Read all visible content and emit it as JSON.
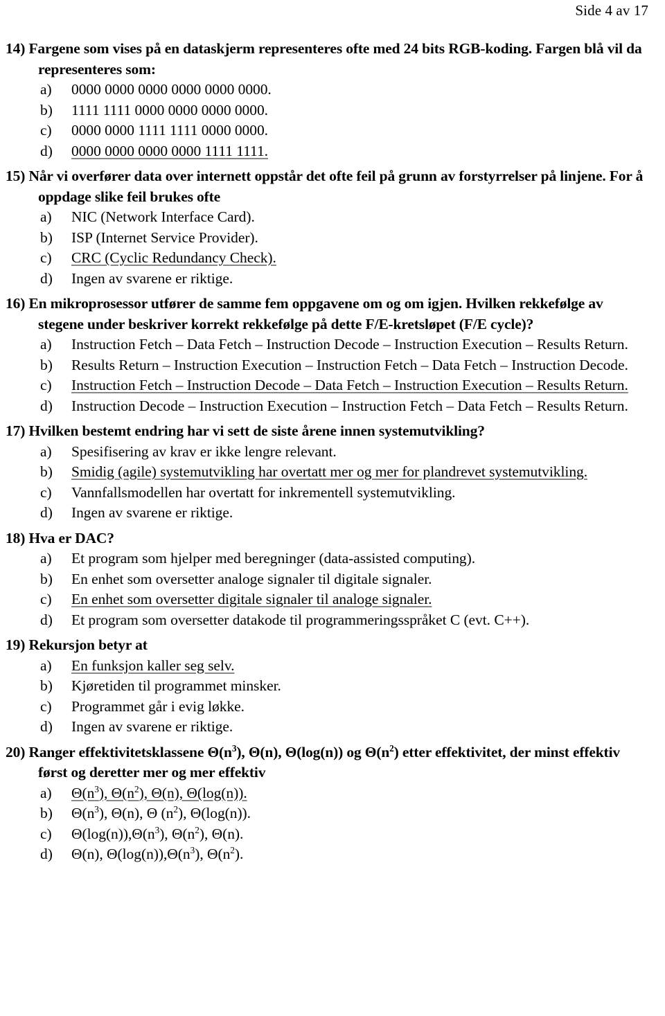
{
  "header": {
    "page_label": "Side 4 av 17"
  },
  "questions": [
    {
      "number": "14)",
      "stem": "Fargene som vises på en dataskjerm representeres ofte med 24 bits RGB-koding. Fargen blå vil da representeres som:",
      "options": [
        {
          "letter": "a)",
          "text": "0000 0000 0000 0000 0000 0000.",
          "answer": false
        },
        {
          "letter": "b)",
          "text": "1111 1111 0000 0000 0000 0000.",
          "answer": false
        },
        {
          "letter": "c)",
          "text": "0000 0000 1111 1111 0000 0000.",
          "answer": false
        },
        {
          "letter": "d)",
          "text": "0000 0000 0000 0000 1111 1111.",
          "answer": true
        }
      ]
    },
    {
      "number": "15)",
      "stem": "Når vi overfører data over internett oppstår det ofte feil på grunn av forstyrrelser på linjene. For å oppdage slike feil brukes ofte",
      "options": [
        {
          "letter": "a)",
          "text": "NIC (Network Interface Card).",
          "answer": false
        },
        {
          "letter": "b)",
          "text": "ISP (Internet Service Provider).",
          "answer": false
        },
        {
          "letter": "c)",
          "text": "CRC (Cyclic Redundancy Check).",
          "answer": true
        },
        {
          "letter": "d)",
          "text": "Ingen av svarene er riktige.",
          "answer": false
        }
      ]
    },
    {
      "number": "16)",
      "stem": "En mikroprosessor utfører de samme fem oppgavene om og om igjen. Hvilken rekkefølge av stegene under beskriver korrekt rekkefølge på dette F/E-kretsløpet (F/E cycle)?",
      "options": [
        {
          "letter": "a)",
          "text": "Instruction Fetch – Data Fetch – Instruction Decode – Instruction Execution – Results Return.",
          "answer": false
        },
        {
          "letter": "b)",
          "text": "Results Return – Instruction Execution – Instruction Fetch – Data Fetch – Instruction Decode.",
          "answer": false
        },
        {
          "letter": "c)",
          "text": "Instruction Fetch – Instruction Decode – Data Fetch – Instruction Execution – Results Return.",
          "answer": true
        },
        {
          "letter": "d)",
          "text": "Instruction Decode – Instruction Execution – Instruction Fetch – Data Fetch – Results Return.",
          "answer": false
        }
      ]
    },
    {
      "number": "17)",
      "stem": "Hvilken bestemt endring har vi sett de siste årene innen systemutvikling?",
      "options": [
        {
          "letter": "a)",
          "text": "Spesifisering av krav er ikke lengre relevant.",
          "answer": false
        },
        {
          "letter": "b)",
          "text": "Smidig (agile) systemutvikling har overtatt mer og mer for plandrevet systemutvikling.",
          "answer": true
        },
        {
          "letter": "c)",
          "text": "Vannfallsmodellen har overtatt for inkrementell systemutvikling.",
          "answer": false
        },
        {
          "letter": "d)",
          "text": "Ingen av svarene er riktige.",
          "answer": false
        }
      ]
    },
    {
      "number": "18)",
      "stem": "Hva er DAC?",
      "options": [
        {
          "letter": "a)",
          "text": "Et program som hjelper med beregninger (data-assisted computing).",
          "answer": false
        },
        {
          "letter": "b)",
          "text": "En enhet som oversetter analoge signaler til digitale signaler.",
          "answer": false
        },
        {
          "letter": "c)",
          "text": "En enhet som oversetter digitale signaler til analoge signaler.",
          "answer": true
        },
        {
          "letter": "d)",
          "text": "Et program som oversetter datakode til programmeringsspråket C (evt. C++).",
          "answer": false
        }
      ]
    },
    {
      "number": "19)",
      "stem": "Rekursjon betyr at",
      "options": [
        {
          "letter": "a)",
          "text": "En funksjon kaller seg selv.",
          "answer": true
        },
        {
          "letter": "b)",
          "text": "Kjøretiden til programmet minsker.",
          "answer": false
        },
        {
          "letter": "c)",
          "text": "Programmet går i evig løkke.",
          "answer": false
        },
        {
          "letter": "d)",
          "text": "Ingen av svarene er riktige.",
          "answer": false
        }
      ]
    },
    {
      "number": "20)",
      "stem_html": "Ranger effektivitetsklassene Θ(n<sup>3</sup>), Θ(n), Θ(log(n)) og Θ(n<sup>2</sup>) etter effektivitet, der minst effektiv først og deretter mer og mer effektiv",
      "stem": "Ranger effektivitetsklassene Θ(n3), Θ(n), Θ(log(n)) og Θ(n2) etter effektivitet, der minst effektiv først og deretter mer og mer effektiv",
      "options": [
        {
          "letter": "a)",
          "text": "Θ(n3), Θ(n2), Θ(n), Θ(log(n)).",
          "text_html": "Θ(n<sup>3</sup>), Θ(n<sup>2</sup>), Θ(n), Θ(log(n)).",
          "answer": true
        },
        {
          "letter": "b)",
          "text": "Θ(n3), Θ(n), Θ (n2), Θ(log(n)).",
          "text_html": "Θ(n<sup>3</sup>), Θ(n), Θ (n<sup>2</sup>), Θ(log(n)).",
          "answer": false
        },
        {
          "letter": "c)",
          "text": "Θ(log(n)),Θ(n3), Θ(n2), Θ(n).",
          "text_html": "Θ(log(n)),Θ(n<sup>3</sup>), Θ(n<sup>2</sup>), Θ(n).",
          "answer": false
        },
        {
          "letter": "d)",
          "text": "Θ(n), Θ(log(n)),Θ(n3), Θ(n2).",
          "text_html": "Θ(n), Θ(log(n)),Θ(n<sup>3</sup>), Θ(n<sup>2</sup>).",
          "answer": false
        }
      ]
    }
  ]
}
